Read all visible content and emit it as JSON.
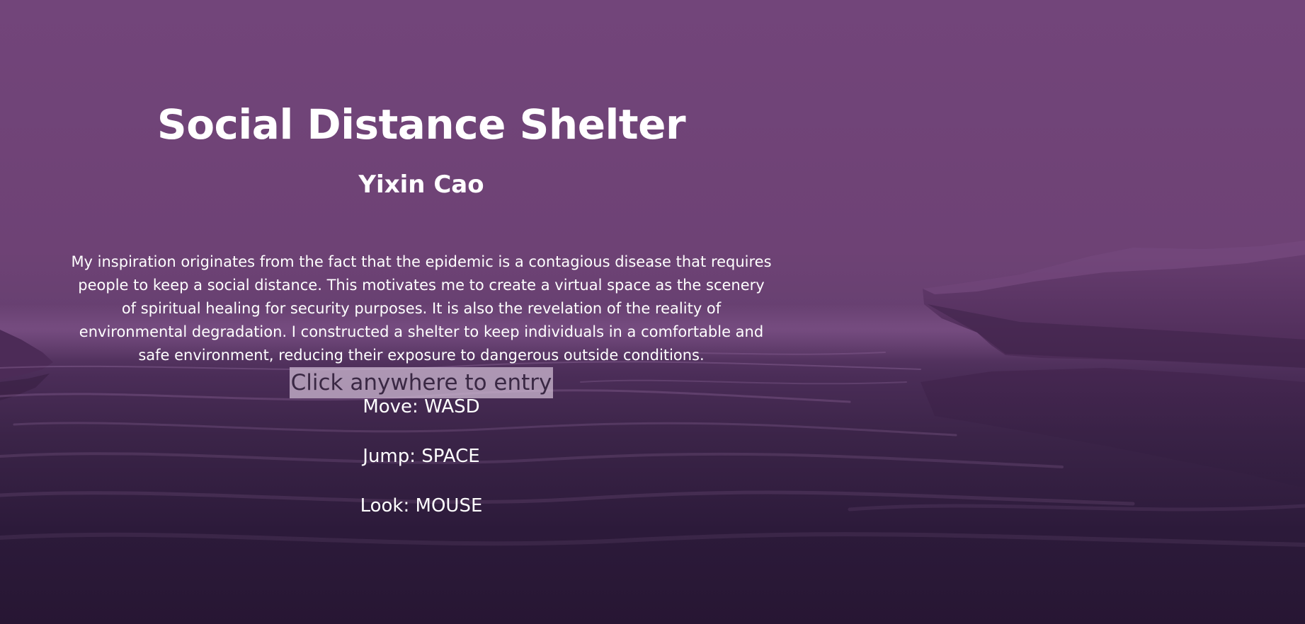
{
  "game": {
    "title": "Social Distance Shelter",
    "author": "Yixin Cao",
    "description": "My inspiration originates from the fact that the epidemic is a contagious disease that requires people to keep a social distance. This motivates me to create a virtual space as the scenery of spiritual healing for security purposes. It is also the revelation of the reality of environmental degradation. I constructed a shelter to keep individuals in a comfortable and safe environment, reducing their exposure to dangerous outside conditions.",
    "cta": "Click anywhere to entry",
    "controls": [
      {
        "text": "Move: WASD"
      },
      {
        "text": "Jump: SPACE"
      },
      {
        "text": "Look: MOUSE"
      }
    ]
  },
  "colors": {
    "sky": "#6e4275",
    "water_dark": "#271633",
    "rock": "#5a3563",
    "text": "#ffffff",
    "cta_bg": "#cdb9d2"
  }
}
